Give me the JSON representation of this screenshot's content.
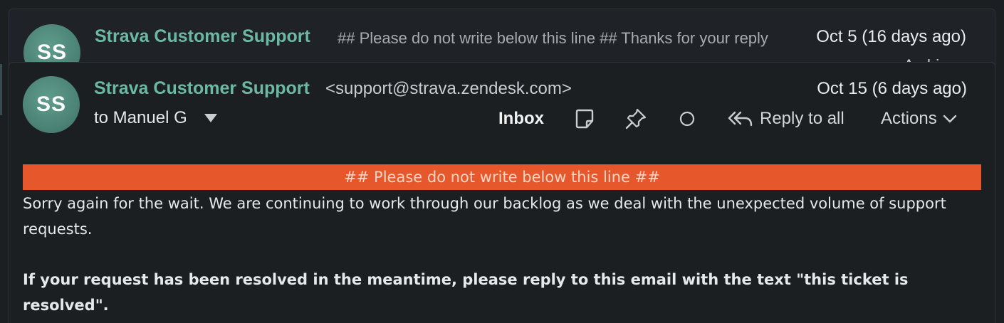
{
  "thread": {
    "collapsed_message": {
      "avatar_initials": "SS",
      "sender": "Strava Customer Support",
      "snippet": "## Please do not write below this line ## Thanks for your reply",
      "date": "Oct 5 (16 days ago)",
      "peek_text": "Archive"
    },
    "expanded_message": {
      "avatar_initials": "SS",
      "sender": "Strava Customer Support",
      "email": "<support@strava.zendesk.com>",
      "date": "Oct 15 (6 days ago)",
      "to_line": "to Manuel G",
      "toolbar": {
        "inbox_label": "Inbox",
        "note_icon": "note-icon",
        "pin_icon": "pin-icon",
        "unread_icon": "circle-icon",
        "reply_all_label": "Reply to all",
        "actions_label": "Actions"
      },
      "banner_text": "## Please do not write below this line ##",
      "paragraphs": [
        "Sorry again for the wait. We are continuing to work through our backlog as we deal with the unexpected volume of support requests.",
        "If your request has been resolved in the meantime, please reply to this email with the text \"this ticket is resolved\"."
      ]
    }
  },
  "colors": {
    "background": "#1c1f22",
    "sender_accent": "#6bb9a3",
    "avatar": "#4c8476",
    "banner": "#e6582b"
  }
}
